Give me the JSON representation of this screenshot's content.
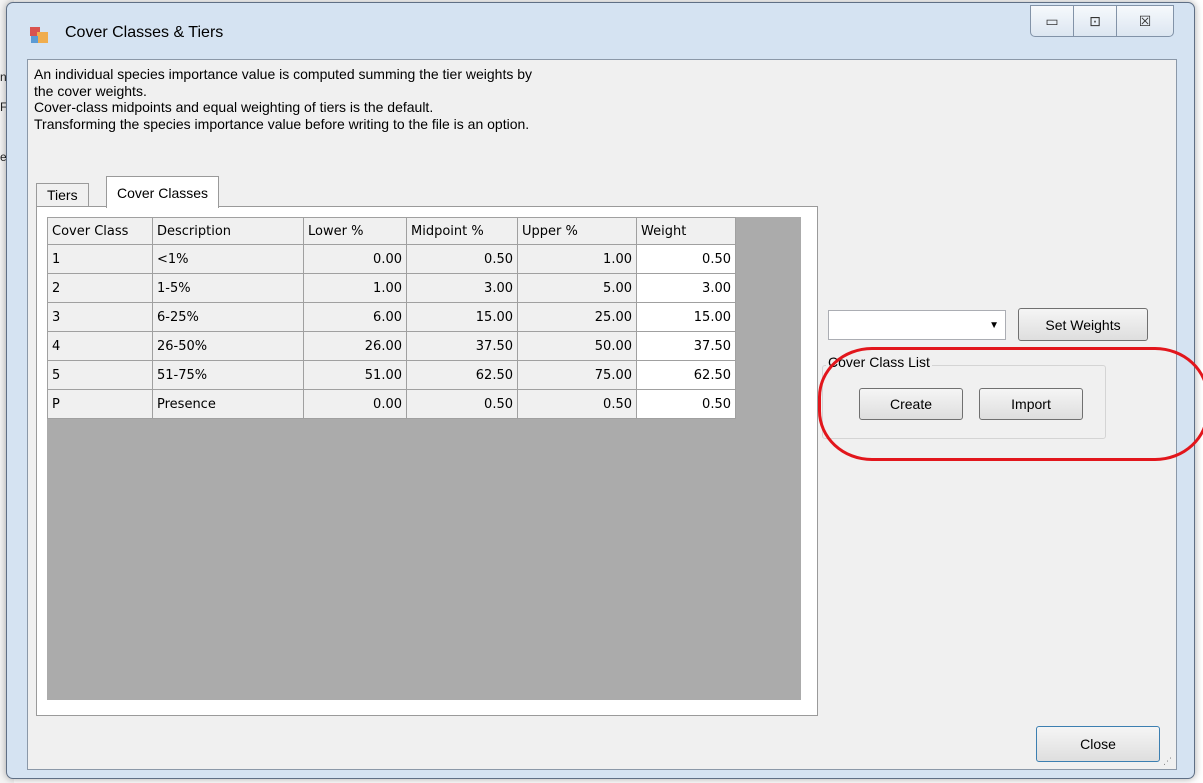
{
  "window": {
    "title": "Cover Classes & Tiers",
    "controls": {
      "minimize": "▭",
      "maximize": "⊡",
      "close": "☒"
    }
  },
  "description": [
    "An individual species importance value is computed summing the tier weights by",
    "the cover weights.",
    "Cover-class midpoints and equal weighting of tiers is the default.",
    "Transforming the species importance value before writing to the file is an option."
  ],
  "tabs": [
    {
      "label": "Tiers",
      "active": false
    },
    {
      "label": "Cover Classes",
      "active": true
    }
  ],
  "table": {
    "columns": [
      "Cover Class",
      "Description",
      "Lower %",
      "Midpoint %",
      "Upper %",
      "Weight"
    ],
    "rows": [
      [
        "1",
        "<1%",
        "0.00",
        "0.50",
        "1.00",
        "0.50"
      ],
      [
        "2",
        "1-5%",
        "1.00",
        "3.00",
        "5.00",
        "3.00"
      ],
      [
        "3",
        "6-25%",
        "6.00",
        "15.00",
        "25.00",
        "15.00"
      ],
      [
        "4",
        "26-50%",
        "26.00",
        "37.50",
        "50.00",
        "37.50"
      ],
      [
        "5",
        "51-75%",
        "51.00",
        "62.50",
        "75.00",
        "62.50"
      ],
      [
        "P",
        "Presence",
        "0.00",
        "0.50",
        "0.50",
        "0.50"
      ]
    ]
  },
  "weights_combo": {
    "value": ""
  },
  "buttons": {
    "set_weights": "Set Weights",
    "create": "Create",
    "import": "Import",
    "close": "Close"
  },
  "cover_class_group": {
    "label": "Cover Class List"
  },
  "colors": {
    "annotation": "#e2161c",
    "grid_background": "#ababab"
  }
}
